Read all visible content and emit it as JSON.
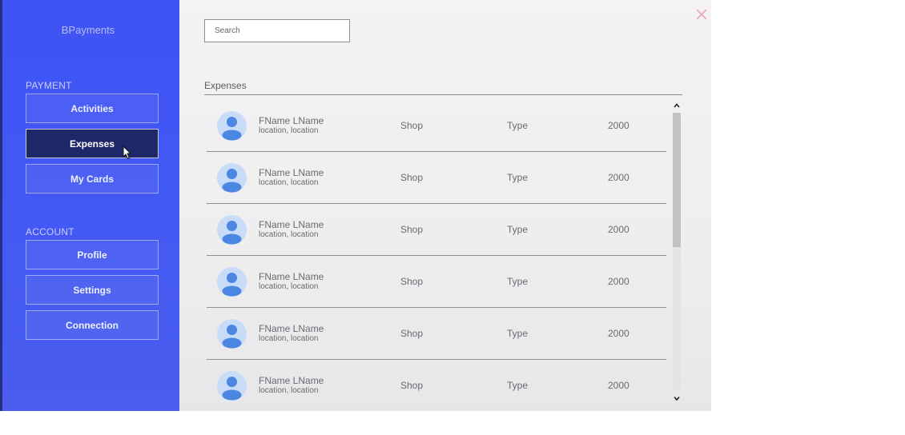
{
  "app": {
    "brand": "BPayments"
  },
  "sidebar": {
    "payment_section": "PAYMENT",
    "account_section": "ACCOUNT",
    "payment_items": [
      {
        "label": "Activities"
      },
      {
        "label": "Expenses"
      },
      {
        "label": "My Cards"
      }
    ],
    "account_items": [
      {
        "label": "Profile"
      },
      {
        "label": "Settings"
      },
      {
        "label": "Connection"
      }
    ],
    "active_item": "Expenses"
  },
  "main": {
    "search": {
      "placeholder": "Search"
    },
    "list_title": "Expenses",
    "rows": [
      {
        "name": "FName LName",
        "location": "location, location",
        "shop": "Shop",
        "type": "Type",
        "amount": "2000"
      },
      {
        "name": "FName LName",
        "location": "location, location",
        "shop": "Shop",
        "type": "Type",
        "amount": "2000"
      },
      {
        "name": "FName LName",
        "location": "location, location",
        "shop": "Shop",
        "type": "Type",
        "amount": "2000"
      },
      {
        "name": "FName LName",
        "location": "location, location",
        "shop": "Shop",
        "type": "Type",
        "amount": "2000"
      },
      {
        "name": "FName LName",
        "location": "location, location",
        "shop": "Shop",
        "type": "Type",
        "amount": "2000"
      },
      {
        "name": "FName LName",
        "location": "location, location",
        "shop": "Shop",
        "type": "Type",
        "amount": "2000"
      }
    ]
  },
  "icons": {
    "close": "close-icon",
    "avatar": "user-avatar-icon",
    "scroll_up": "chevron-up-icon",
    "scroll_down": "chevron-down-icon",
    "cursor": "mouse-cursor-icon"
  },
  "colors": {
    "sidebar_bg": "#3f53f6",
    "active_button_bg": "#1e2869",
    "close_icon": "#f0a4b4",
    "avatar_bg": "#c9dcf7",
    "avatar_figure": "#4a86e2"
  }
}
